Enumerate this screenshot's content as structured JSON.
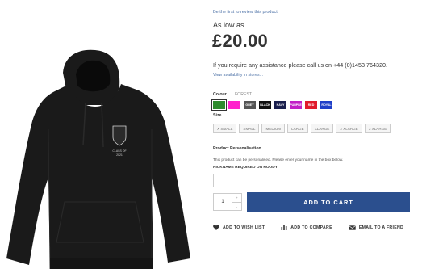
{
  "product": {
    "review_link": "Be the first to review this product",
    "as_low_as": "As low as",
    "price": "£20.00",
    "assistance": "If you require any assistance please call us on +44 (0)1453 764320.",
    "availability_link": "View availability in stores..."
  },
  "colour": {
    "label": "Colour",
    "selected": "FOREST",
    "swatches": [
      {
        "label": "",
        "color": "#2e8b2e",
        "selected": true
      },
      {
        "label": "",
        "color": "#ff22cc",
        "selected": false
      },
      {
        "label": "GREY",
        "color": "#555555",
        "selected": false
      },
      {
        "label": "BLACK",
        "color": "#111111",
        "selected": false
      },
      {
        "label": "NAVY",
        "color": "#1a1f4d",
        "selected": false
      },
      {
        "label": "PURPLE",
        "color": "#c11fc6",
        "selected": false
      },
      {
        "label": "RED",
        "color": "#e01b2b",
        "selected": false
      },
      {
        "label": "ROYAL",
        "color": "#1f3fc8",
        "selected": false
      }
    ]
  },
  "size": {
    "label": "Size",
    "options": [
      "X SMALL",
      "SMALL",
      "MEDIUM",
      "LARGE",
      "XLARGE",
      "2 XLARGE",
      "3 XLARGE"
    ]
  },
  "personalisation": {
    "title": "Product Personalisation",
    "description": "This product can be personalised. Please enter your name in the box below.",
    "nickname_label": "NICKNAME REQUIRED ON HOODY",
    "nickname_value": ""
  },
  "cart": {
    "quantity": "1",
    "up_arrow": "+",
    "down_arrow": "-",
    "add_label": "ADD TO CART"
  },
  "actions": {
    "wishlist": "ADD TO WISH LIST",
    "compare": "ADD TO COMPARE",
    "email": "EMAIL TO A FRIEND"
  },
  "image": {
    "hoodie_color": "#1a1a1a",
    "crest_text_1": "CLASS OF",
    "crest_text_2": "2021"
  }
}
